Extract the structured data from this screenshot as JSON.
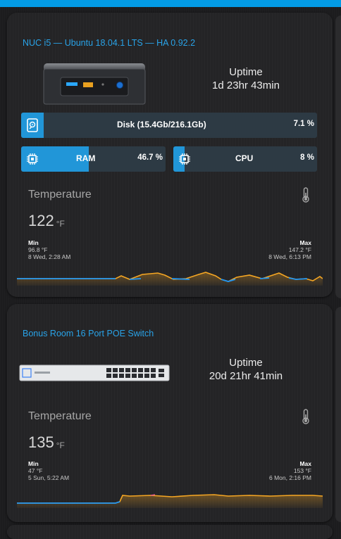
{
  "cards": [
    {
      "title": "NUC i5 — Ubuntu 18.04.1 LTS — HA 0.92.2",
      "device_image": "intel-nuc-image",
      "uptime_label": "Uptime",
      "uptime_value": "1d 23hr 43min",
      "disk": {
        "label": "Disk (15.4Gb/216.1Gb)",
        "percent_text": "7.1 %",
        "percent": 7.1,
        "icon": "disk-icon"
      },
      "ram": {
        "label": "RAM",
        "percent_text": "46.7 %",
        "percent": 46.7,
        "icon": "chip-icon"
      },
      "cpu": {
        "label": "CPU",
        "percent_text": "8 %",
        "percent": 8,
        "icon": "chip-icon"
      },
      "temperature": {
        "label": "Temperature",
        "value": "122",
        "unit": "°F",
        "icon": "thermometer-icon",
        "min_label": "Min",
        "min_value": "96.8 °F",
        "min_time": "8 Wed, 2:28 AM",
        "max_label": "Max",
        "max_value": "147.2 °F",
        "max_time": "8 Wed, 6:13 PM"
      }
    },
    {
      "title": "Bonus Room 16 Port POE Switch",
      "device_image": "poe-switch-image",
      "uptime_label": "Uptime",
      "uptime_value": "20d 21hr 41min",
      "temperature": {
        "label": "Temperature",
        "value": "135",
        "unit": "°F",
        "icon": "thermometer-icon",
        "min_label": "Min",
        "min_value": "47 °F",
        "min_time": "5 Sun, 5:22 AM",
        "max_label": "Max",
        "max_value": "153 °F",
        "max_time": "6 Mon, 2:16 PM"
      }
    }
  ],
  "colors": {
    "accent": "#039be5",
    "title": "#29a3e8",
    "bar_track": "#2d3a44",
    "bar_fill": "#2196d8",
    "graph_low": "#2196f3",
    "graph_high": "#f5a623"
  }
}
